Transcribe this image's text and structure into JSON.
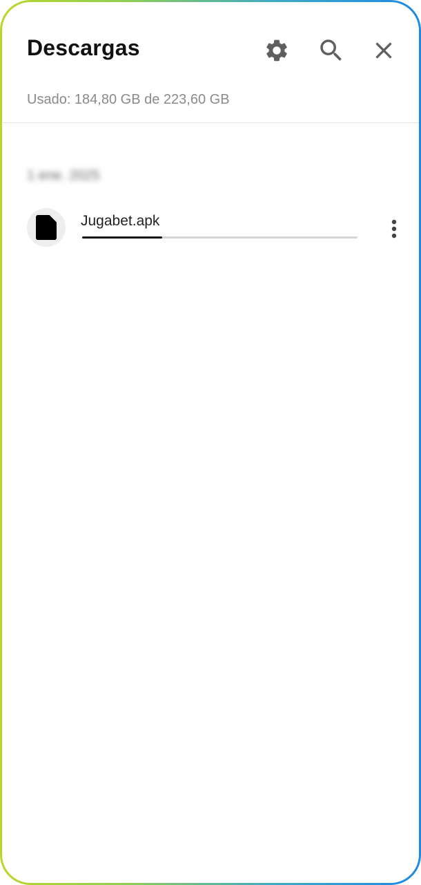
{
  "header": {
    "title": "Descargas",
    "storage_text": "Usado: 184,80 GB de 223,60 GB",
    "icons": [
      "gear-icon",
      "search-icon",
      "close-icon"
    ]
  },
  "downloads": {
    "date_group": "1 ene. 2025",
    "items": [
      {
        "name": "Jugabet.apk",
        "icon": "file-icon",
        "progress": 0.29
      }
    ]
  },
  "colors": {
    "accent": "#111111",
    "progress_track": "#d6d6d6",
    "border_gradient_start": "#b9d72a",
    "border_gradient_end": "#1e88e5"
  }
}
